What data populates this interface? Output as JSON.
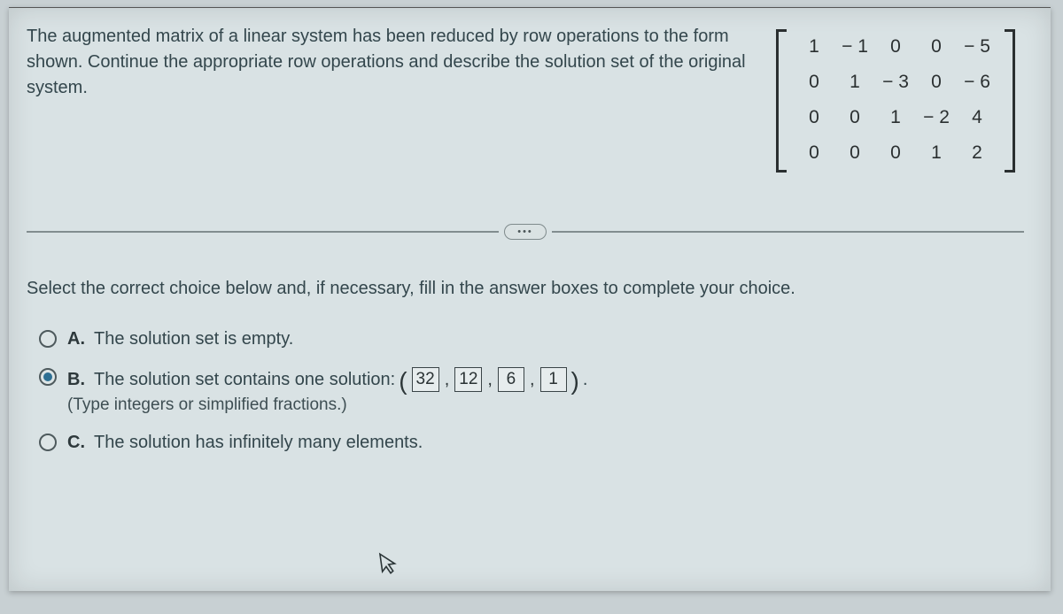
{
  "question": "The augmented matrix of a linear system has been reduced by row operations to the form shown. Continue the appropriate row operations and describe the solution set of the original system.",
  "matrix": {
    "rows": [
      [
        "1",
        "− 1",
        "0",
        "0",
        "− 5"
      ],
      [
        "0",
        "1",
        "− 3",
        "0",
        "− 6"
      ],
      [
        "0",
        "0",
        "1",
        "− 2",
        "4"
      ],
      [
        "0",
        "0",
        "0",
        "1",
        "2"
      ]
    ]
  },
  "dots": "•••",
  "instruction": "Select the correct choice below and, if necessary, fill in the answer boxes to complete your choice.",
  "choices": {
    "a": {
      "letter": "A.",
      "text": "The solution set is empty."
    },
    "b": {
      "letter": "B.",
      "text": "The solution set contains one solution:",
      "hint": "(Type integers or simplified fractions.)",
      "values": [
        "32",
        "12",
        "6",
        "1"
      ]
    },
    "c": {
      "letter": "C.",
      "text": "The solution has infinitely many elements."
    }
  }
}
